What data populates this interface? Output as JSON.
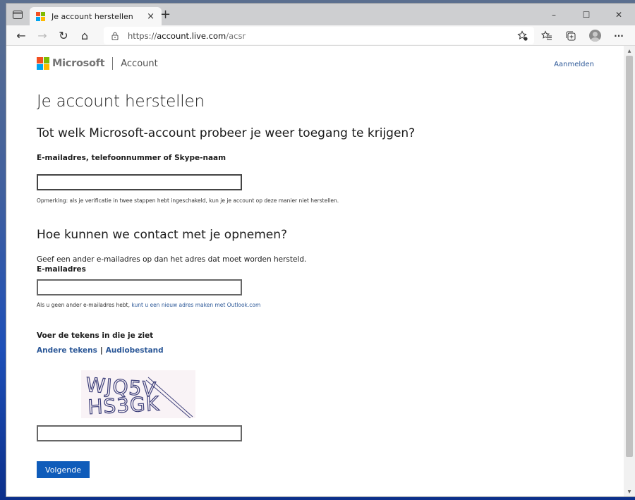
{
  "browser": {
    "tab": {
      "title": "Je account herstellen",
      "favicon": "microsoft-logo",
      "close_icon": "×"
    },
    "new_tab_icon": "+",
    "window_controls": {
      "minimize": "–",
      "maximize": "☐",
      "close": "✕"
    },
    "nav": {
      "back": "←",
      "forward": "→",
      "refresh": "↻",
      "home": "⌂"
    },
    "address": {
      "scheme": "https://",
      "host": "account.live.com",
      "path": "/acsr"
    },
    "toolbar_icons": [
      "add-favorite-icon",
      "favorites-icon",
      "collections-icon",
      "profile-avatar",
      "more-icon"
    ],
    "more_label": "···"
  },
  "page": {
    "brand": {
      "name": "Microsoft",
      "product": "Account"
    },
    "signin_link": "Aanmelden",
    "title": "Je account herstellen",
    "section1": {
      "heading": "Tot welk Microsoft-account probeer je weer toegang te krijgen?",
      "field_label": "E-mailadres, telefoonnummer of Skype-naam",
      "field_value": "",
      "note": "Opmerking: als je verificatie in twee stappen hebt ingeschakeld, kun je je account op deze manier niet herstellen."
    },
    "section2": {
      "heading": "Hoe kunnen we contact met je opnemen?",
      "description": "Geef een ander e-mailadres op dan het adres dat moet worden hersteld.",
      "field_label": "E-mailadres",
      "field_value": "",
      "note_prefix": "Als u geen ander e-mailadres hebt, ",
      "note_link": "kunt u een nieuw adres maken met Outlook.com"
    },
    "captcha": {
      "label": "Voer de tekens in die je ziet",
      "link_new": "Andere tekens",
      "separator": "|",
      "link_audio": "Audiobestand",
      "line1": "WJQ5V",
      "line2": "HS3GK",
      "field_value": ""
    },
    "next_button": "Volgende"
  }
}
